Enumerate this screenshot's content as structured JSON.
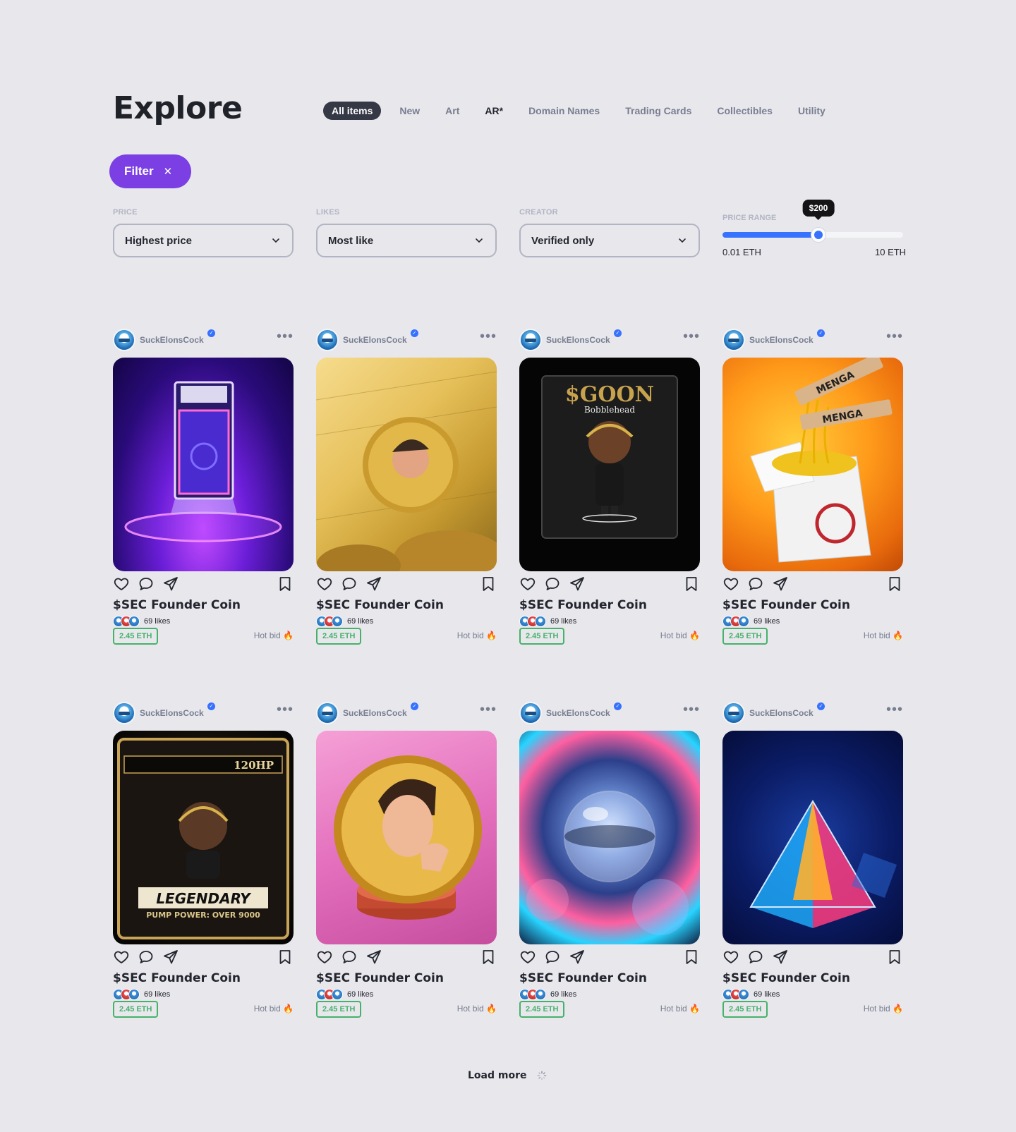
{
  "header": {
    "title": "Explore",
    "tabs": [
      {
        "label": "All items",
        "active": true
      },
      {
        "label": "New"
      },
      {
        "label": "Art"
      },
      {
        "label": "AR*"
      },
      {
        "label": "Domain Names"
      },
      {
        "label": "Trading Cards"
      },
      {
        "label": "Collectibles"
      },
      {
        "label": "Utility"
      }
    ]
  },
  "filter": {
    "button_label": "Filter",
    "close_glyph": "✕",
    "price": {
      "label": "PRICE",
      "value": "Highest price"
    },
    "likes": {
      "label": "LIKES",
      "value": "Most like"
    },
    "creator": {
      "label": "CREATOR",
      "value": "Verified only"
    },
    "price_range": {
      "label": "PRICE RANGE",
      "tooltip": "$200",
      "min_label": "0.01 ETH",
      "max_label": "10 ETH",
      "fill_fraction": 0.53
    }
  },
  "colors": {
    "accent": "#7b3fe4",
    "slider": "#3772ff",
    "price_green": "#45b26b"
  },
  "cards": [
    {
      "creator": "SuckElonsCock",
      "title": "$SEC Founder Coin",
      "likes": "69 likes",
      "price": "2.45 ETH",
      "status": "Hot bid 🔥",
      "art": "neon-trading-card-slab"
    },
    {
      "creator": "SuckElonsCock",
      "title": "$SEC Founder Coin",
      "likes": "69 likes",
      "price": "2.45 ETH",
      "status": "Hot bid 🔥",
      "art": "gold-coin-on-ticket"
    },
    {
      "creator": "SuckElonsCock",
      "title": "$SEC Founder Coin",
      "likes": "69 likes",
      "price": "2.45 ETH",
      "status": "Hot bid 🔥",
      "art": "bobblehead-box",
      "art_text": "$GOON",
      "art_subtext": "Bobblehead"
    },
    {
      "creator": "SuckElonsCock",
      "title": "$SEC Founder Coin",
      "likes": "69 likes",
      "price": "2.45 ETH",
      "status": "Hot bid 🔥",
      "art": "noodle-box",
      "art_text": "MENGA"
    },
    {
      "creator": "SuckElonsCock",
      "title": "$SEC Founder Coin",
      "likes": "69 likes",
      "price": "2.45 ETH",
      "status": "Hot bid 🔥",
      "art": "legendary-card",
      "art_text": "LEGENDARY",
      "art_subtext": "PUMP POWER: OVER 9000",
      "art_hp": "120HP"
    },
    {
      "creator": "SuckElonsCock",
      "title": "$SEC Founder Coin",
      "likes": "69 likes",
      "price": "2.45 ETH",
      "status": "Hot bid 🔥",
      "art": "gold-coin-pink"
    },
    {
      "creator": "SuckElonsCock",
      "title": "$SEC Founder Coin",
      "likes": "69 likes",
      "price": "2.45 ETH",
      "status": "Hot bid 🔥",
      "art": "glass-marbles"
    },
    {
      "creator": "SuckElonsCock",
      "title": "$SEC Founder Coin",
      "likes": "69 likes",
      "price": "2.45 ETH",
      "status": "Hot bid 🔥",
      "art": "neon-pyramid"
    }
  ],
  "load_more": {
    "label": "Load more"
  },
  "icons": [
    "chevron-down-icon",
    "heart-icon",
    "comment-icon",
    "share-icon",
    "bookmark-icon",
    "more-icon",
    "verified-icon",
    "spinner-icon"
  ]
}
